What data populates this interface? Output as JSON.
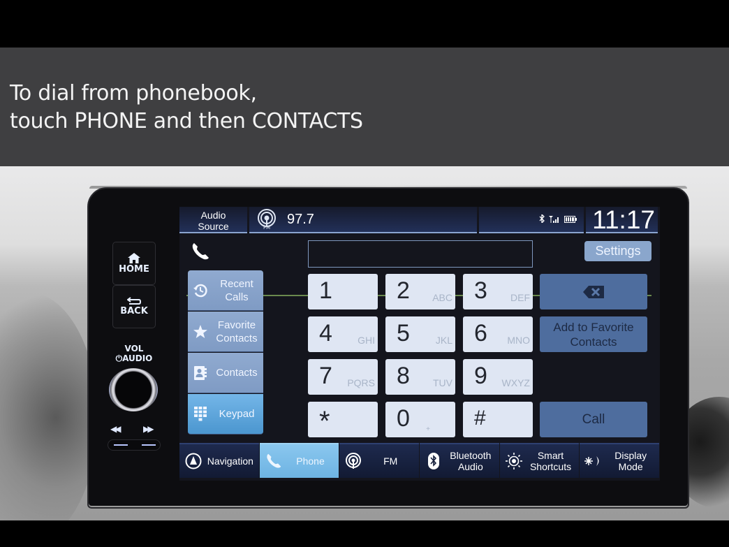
{
  "caption": {
    "line1": "To dial from phonebook,",
    "line2": "touch PHONE and then CONTACTS"
  },
  "hard_keys": {
    "home": "HOME",
    "back": "BACK",
    "vol_line1": "VOL",
    "vol_line2": "AUDIO"
  },
  "status_bar": {
    "audio_source_line1": "Audio",
    "audio_source_line2": "Source",
    "band_icon_label": "FM",
    "frequency": "97.7",
    "clock": "11:17",
    "indicators": [
      "bluetooth-icon",
      "signal-icon",
      "battery-icon"
    ]
  },
  "phone": {
    "dialed_number": "",
    "settings_label": "Settings"
  },
  "side_menu": [
    {
      "line1": "Recent",
      "line2": "Calls",
      "icon": "recent-calls-icon",
      "active": false
    },
    {
      "line1": "Favorite",
      "line2": "Contacts",
      "icon": "star-icon",
      "active": false
    },
    {
      "line1": "Contacts",
      "line2": "",
      "icon": "contacts-book-icon",
      "active": false
    },
    {
      "line1": "Keypad",
      "line2": "",
      "icon": "keypad-icon",
      "active": true
    }
  ],
  "keypad": [
    {
      "digit": "1",
      "letters": ""
    },
    {
      "digit": "2",
      "letters": "ABC"
    },
    {
      "digit": "3",
      "letters": "DEF"
    },
    {
      "digit": "4",
      "letters": "GHI"
    },
    {
      "digit": "5",
      "letters": "JKL"
    },
    {
      "digit": "6",
      "letters": "MNO"
    },
    {
      "digit": "7",
      "letters": "PQRS"
    },
    {
      "digit": "8",
      "letters": "TUV"
    },
    {
      "digit": "9",
      "letters": "WXYZ"
    },
    {
      "digit": "*",
      "letters": ""
    },
    {
      "digit": "0",
      "letters": "+"
    },
    {
      "digit": "#",
      "letters": ""
    }
  ],
  "actions": {
    "add_favorite_line1": "Add to Favorite",
    "add_favorite_line2": "Contacts",
    "call": "Call"
  },
  "bottom_nav": [
    {
      "line1": "Navigation",
      "line2": "",
      "icon": "navigation-icon",
      "active": false
    },
    {
      "line1": "Phone",
      "line2": "",
      "icon": "phone-icon",
      "active": true
    },
    {
      "line1": "FM",
      "line2": "",
      "icon": "radio-icon",
      "active": false
    },
    {
      "line1": "Bluetooth",
      "line2": "Audio",
      "icon": "bluetooth-icon",
      "active": false
    },
    {
      "line1": "Smart",
      "line2": "Shortcuts",
      "icon": "smart-shortcuts-icon",
      "active": false
    },
    {
      "line1": "Display",
      "line2": "Mode",
      "icon": "display-mode-icon",
      "active": false
    }
  ],
  "colors": {
    "caption_band": "#3f3f41",
    "menu_item": "#8aa6cc",
    "menu_active": "#5ea8dc",
    "key_face": "#dfe6f3",
    "action_button": "#4e6d9e",
    "separator_green": "#6a8a4e"
  }
}
